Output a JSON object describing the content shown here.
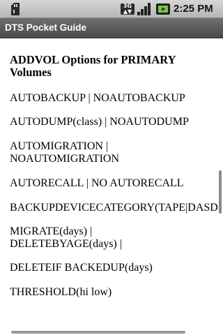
{
  "status_bar": {
    "time": "2:25 PM",
    "network_badge_top": "3G",
    "network_badge_bottom": "",
    "icons": [
      "sd-card-icon",
      "network-3g-icon",
      "signal-icon",
      "battery-charging-icon"
    ]
  },
  "app": {
    "title": "DTS Pocket Guide"
  },
  "content": {
    "heading": "ADDVOL Options for PRIMARY Volumes",
    "options": [
      "AUTOBACKUP  |  NOAUTOBACKUP",
      "AUTODUMP(class)  |  NOAUTODUMP",
      "AUTOMIGRATION  |\nNOAUTOMIGRATION",
      "AUTORECALL  |  NO AUTORECALL",
      "BACKUPDEVICECATEGORY(TAPE|DASD",
      "MIGRATE(days)  |\nDELETEBYAGE(days)  |",
      "DELETEIF BACKEDUP(days)",
      "THRESHOLD(hi low)"
    ]
  },
  "colors": {
    "statusbar": "#c6c6c6",
    "titlebar": "#5a5a5a",
    "background": "#ffffff",
    "text": "#000000"
  }
}
